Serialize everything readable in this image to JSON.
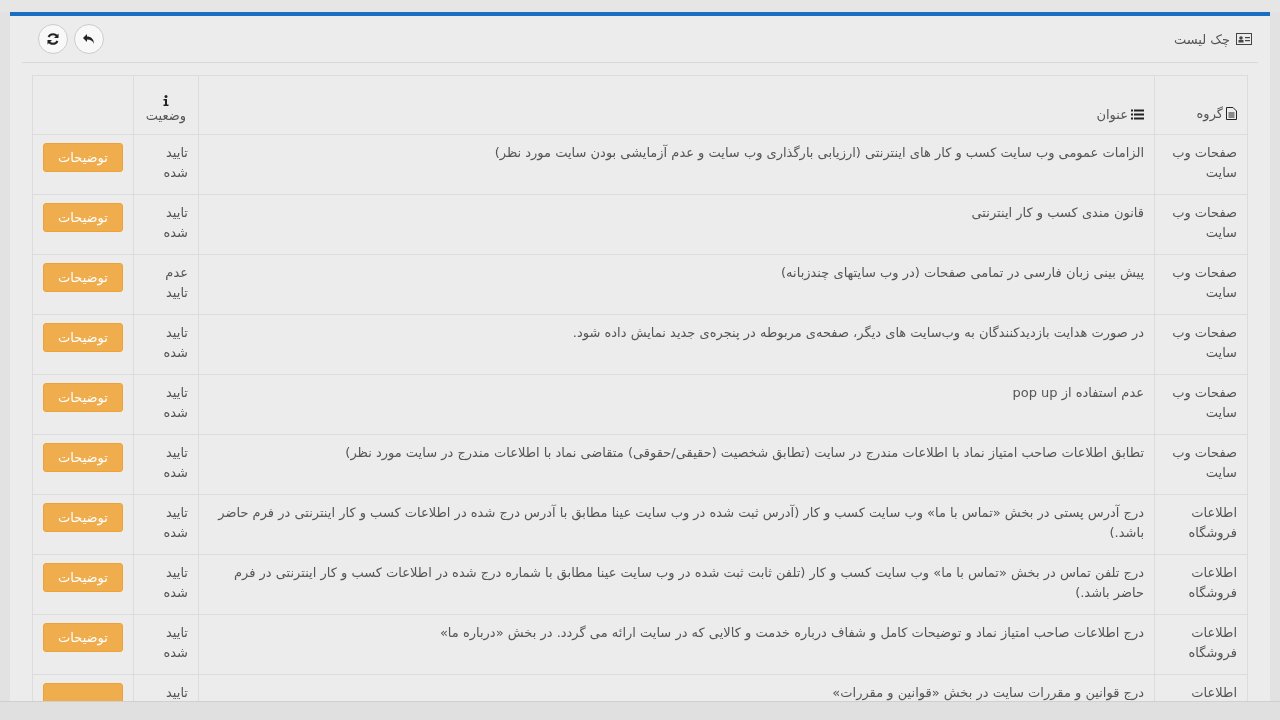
{
  "panel": {
    "title": "چک لیست"
  },
  "table": {
    "columns": [
      {
        "label": "گروه",
        "kind": "file"
      },
      {
        "label": "عنوان",
        "kind": "list"
      },
      {
        "label": "وضعیت",
        "kind": "info"
      }
    ],
    "rows": [
      {
        "group": "صفحات وب سایت",
        "title": "الزامات عمومی وب سایت کسب و کار های اینترنتی (ارزیابی بارگذاری وب سایت و عدم آزمایشی بودن سایت مورد نظر)",
        "status": "تایید شده",
        "action": "توضیحات"
      },
      {
        "group": "صفحات وب سایت",
        "title": "قانون مندی کسب و کار اینترنتی",
        "status": "تایید شده",
        "action": "توضیحات"
      },
      {
        "group": "صفحات وب سایت",
        "title": "پیش بینی زبان فارسی در تمامی صفحات (در وب سایتهای چندزبانه)",
        "status": "عدم تایید",
        "action": "توضیحات"
      },
      {
        "group": "صفحات وب سایت",
        "title": "در صورت هدایت بازدیدکنندگان به وب‌سایت های دیگر، صفحه‌ی مربوطه در پنجره‌ی جدید نمایش داده شود.",
        "status": "تایید شده",
        "action": "توضیحات"
      },
      {
        "group": "صفحات وب سایت",
        "title": "عدم استفاده از pop up",
        "status": "تایید شده",
        "action": "توضیحات"
      },
      {
        "group": "صفحات وب سایت",
        "title": "تطابق اطلاعات صاحب امتیاز نماد با اطلاعات مندرج در سایت (تطابق شخصیت (حقیقی/حقوقی) متقاضی نماد با اطلاعات مندرج در سایت مورد نظر)",
        "status": "تایید شده",
        "action": "توضیحات"
      },
      {
        "group": "اطلاعات فروشگاه",
        "title": "درج آدرس پستی در بخش «تماس با ما» وب سایت کسب و کار (آدرس ثبت شده در وب سایت عینا مطابق با آدرس درج شده در اطلاعات کسب و کار اینترنتی در فرم حاضر باشد.)",
        "status": "تایید شده",
        "action": "توضیحات"
      },
      {
        "group": "اطلاعات فروشگاه",
        "title": "درج تلفن تماس در بخش «تماس با ما» وب سایت کسب و کار (تلفن ثابت ثبت شده در وب سایت عینا مطابق با شماره درج شده در اطلاعات کسب و کار اینترنتی در فرم حاضر باشد.)",
        "status": "تایید شده",
        "action": "توضیحات"
      },
      {
        "group": "اطلاعات فروشگاه",
        "title": "درج اطلاعات صاحب امتیاز نماد و توضیحات کامل و شفاف درباره خدمت و کالایی که در سایت ارائه می گردد. در بخش «درباره ما»",
        "status": "تایید شده",
        "action": "توضیحات"
      },
      {
        "group": "اطلاعات",
        "title": "درج قوانین و مقررات سایت در بخش «قوانین و مقررات»",
        "status": "تایید"
      }
    ]
  }
}
